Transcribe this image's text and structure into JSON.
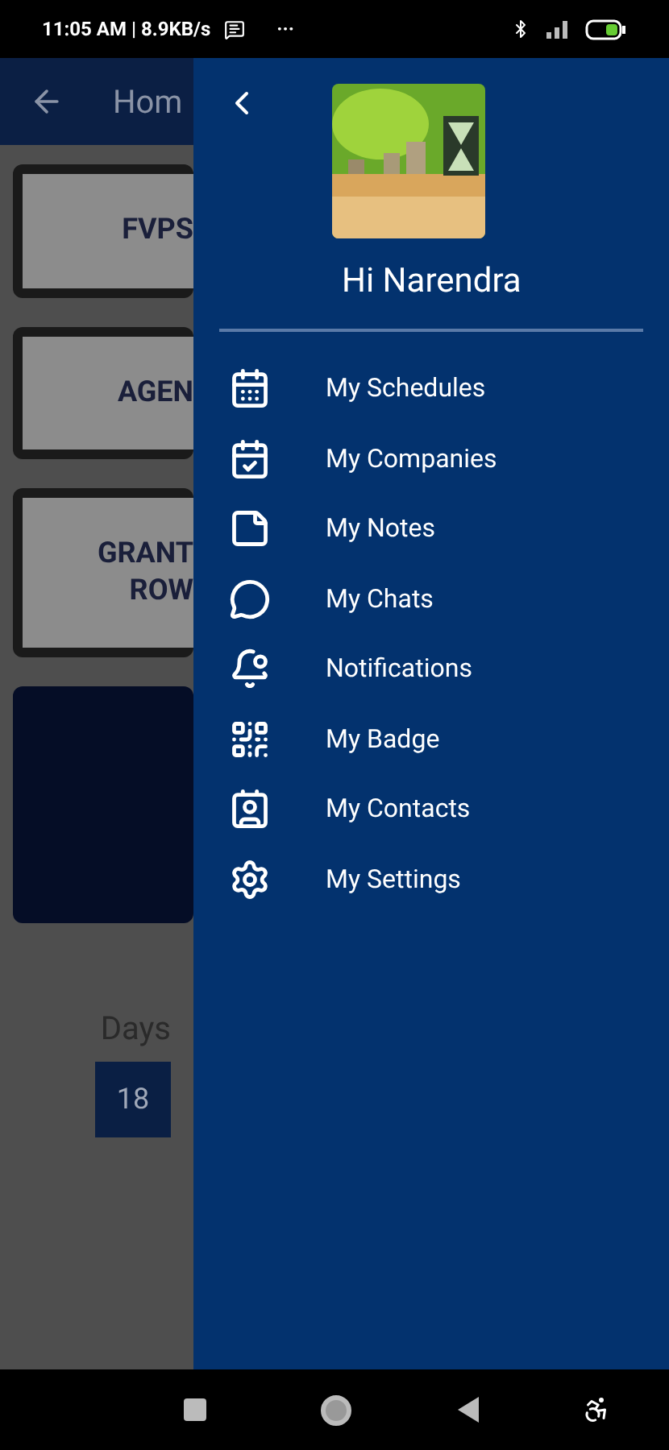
{
  "status_bar": {
    "time": "11:05 AM | 8.9KB/s",
    "more": "···"
  },
  "background": {
    "header_title": "Hom",
    "cards": [
      {
        "kind": "banner",
        "title_lines": [
          "FVPS"
        ]
      },
      {
        "kind": "banner",
        "title_lines": [
          "AGEN"
        ]
      },
      {
        "kind": "banner",
        "title_lines": [
          "GRANT",
          "ROW"
        ]
      },
      {
        "kind": "dark"
      }
    ],
    "countdown": {
      "label": "Days",
      "value": "18"
    }
  },
  "drawer": {
    "greeting": "Hi Narendra",
    "items": [
      {
        "kind": "schedules",
        "label": "My Schedules"
      },
      {
        "kind": "companies",
        "label": "My Companies"
      },
      {
        "kind": "notes",
        "label": "My Notes"
      },
      {
        "kind": "chats",
        "label": "My Chats"
      },
      {
        "kind": "notifications",
        "label": "Notifications"
      },
      {
        "kind": "badge",
        "label": "My Badge"
      },
      {
        "kind": "contacts",
        "label": "My Contacts"
      },
      {
        "kind": "settings",
        "label": "My Settings"
      }
    ]
  }
}
